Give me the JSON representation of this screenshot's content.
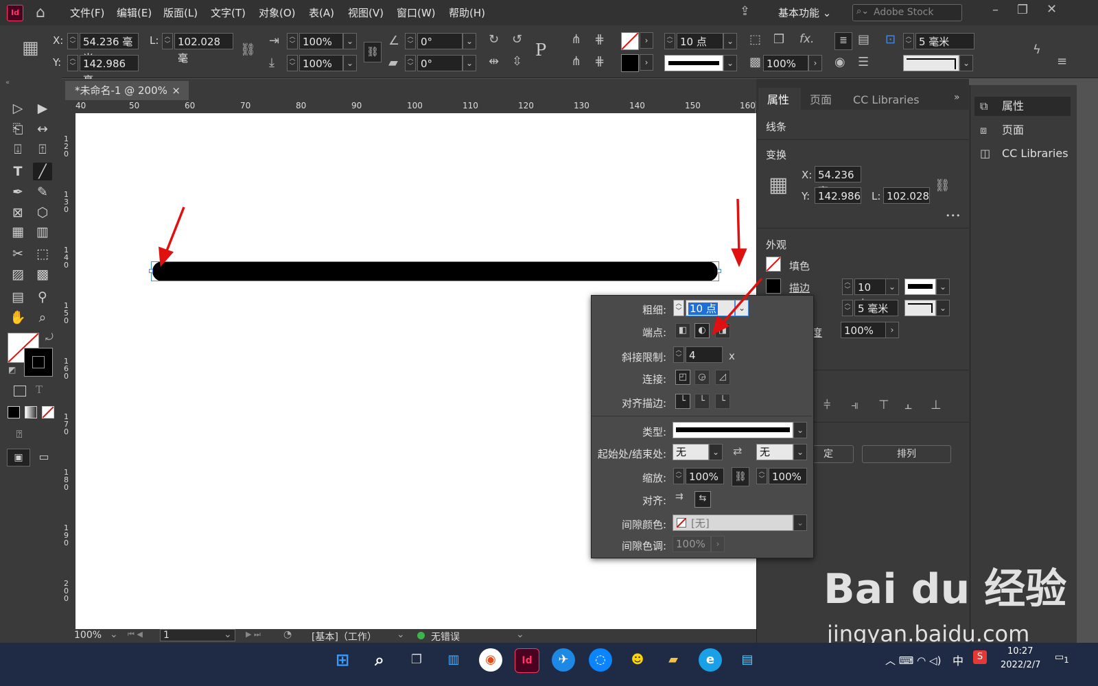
{
  "menu": {
    "logo": "Id",
    "items": [
      "文件(F)",
      "编辑(E)",
      "版面(L)",
      "文字(T)",
      "对象(O)",
      "表(A)",
      "视图(V)",
      "窗口(W)",
      "帮助(H)"
    ],
    "workspace": "基本功能",
    "search_placeholder": "Adobe Stock"
  },
  "control": {
    "x_label": "X:",
    "x_value": "54.236 毫米",
    "y_label": "Y:",
    "y_value": "142.986 毫",
    "l_label": "L:",
    "l_value": "102.028 毫",
    "scale_x": "100%",
    "scale_y": "100%",
    "angle1": "0°",
    "angle2": "0°",
    "stroke_weight": "10 点",
    "opacity": "100%",
    "corner_size": "5 毫米",
    "p_icon": "P",
    "fx": "fx."
  },
  "document": {
    "tab_title": "*未命名-1 @ 200%",
    "close": "×",
    "ruler_h": [
      "40",
      "50",
      "60",
      "70",
      "80",
      "90",
      "100",
      "110",
      "120",
      "130",
      "140",
      "150",
      "160"
    ],
    "ruler_v": [
      "1\n2\n0",
      "1\n3\n0",
      "1\n4\n0",
      "1\n5\n0",
      "1\n6\n0",
      "1\n7\n0",
      "1\n8\n0",
      "1\n9\n0",
      "2\n0\n0"
    ]
  },
  "status": {
    "zoom": "100%",
    "page": "1",
    "base": "[基本]（工作）",
    "preflight": "无错误"
  },
  "properties": {
    "tabs": [
      "属性",
      "页面",
      "CC Libraries"
    ],
    "object_type": "线条",
    "transform_title": "变换",
    "x_label": "X:",
    "x_value": "54.236 毫",
    "y_label": "Y:",
    "y_value": "142.986",
    "l_label": "L:",
    "l_value": "102.028",
    "appearance_title": "外观",
    "fill_label": "填色",
    "stroke_label": "描边",
    "stroke_weight": "10 点",
    "corner": "5 毫米",
    "opacity_label": "度",
    "opacity": "100%",
    "btn_left": "定",
    "btn_arrange": "排列",
    "more": "•••"
  },
  "far_panel": {
    "items": [
      "属性",
      "页面",
      "CC Libraries"
    ]
  },
  "stroke_popup": {
    "weight_label": "粗细:",
    "weight_value": "10 点",
    "cap_label": "端点:",
    "miter_label": "斜接限制:",
    "miter_value": "4",
    "miter_unit": "x",
    "join_label": "连接:",
    "align_label": "对齐描边:",
    "type_label": "类型:",
    "start_end_label": "起始处/结束处:",
    "start_value": "无",
    "end_value": "无",
    "scale_label": "缩放:",
    "scale_start": "100%",
    "scale_end": "100%",
    "align2_label": "对齐:",
    "gap_color_label": "间隙颜色:",
    "gap_color_value": "[无]",
    "gap_tint_label": "间隙色调:",
    "gap_tint_value": "100%"
  },
  "taskbar": {
    "time": "10:27",
    "date": "2022/2/7",
    "ime": "中",
    "app_id": "Id",
    "notify": "1"
  },
  "watermark": {
    "brand": "Bai du 经验",
    "url": "jingyan.baidu.com"
  },
  "colors": {
    "accent": "#4a8cdc",
    "annotation": "#e01010",
    "indesign": "#ff3366"
  }
}
